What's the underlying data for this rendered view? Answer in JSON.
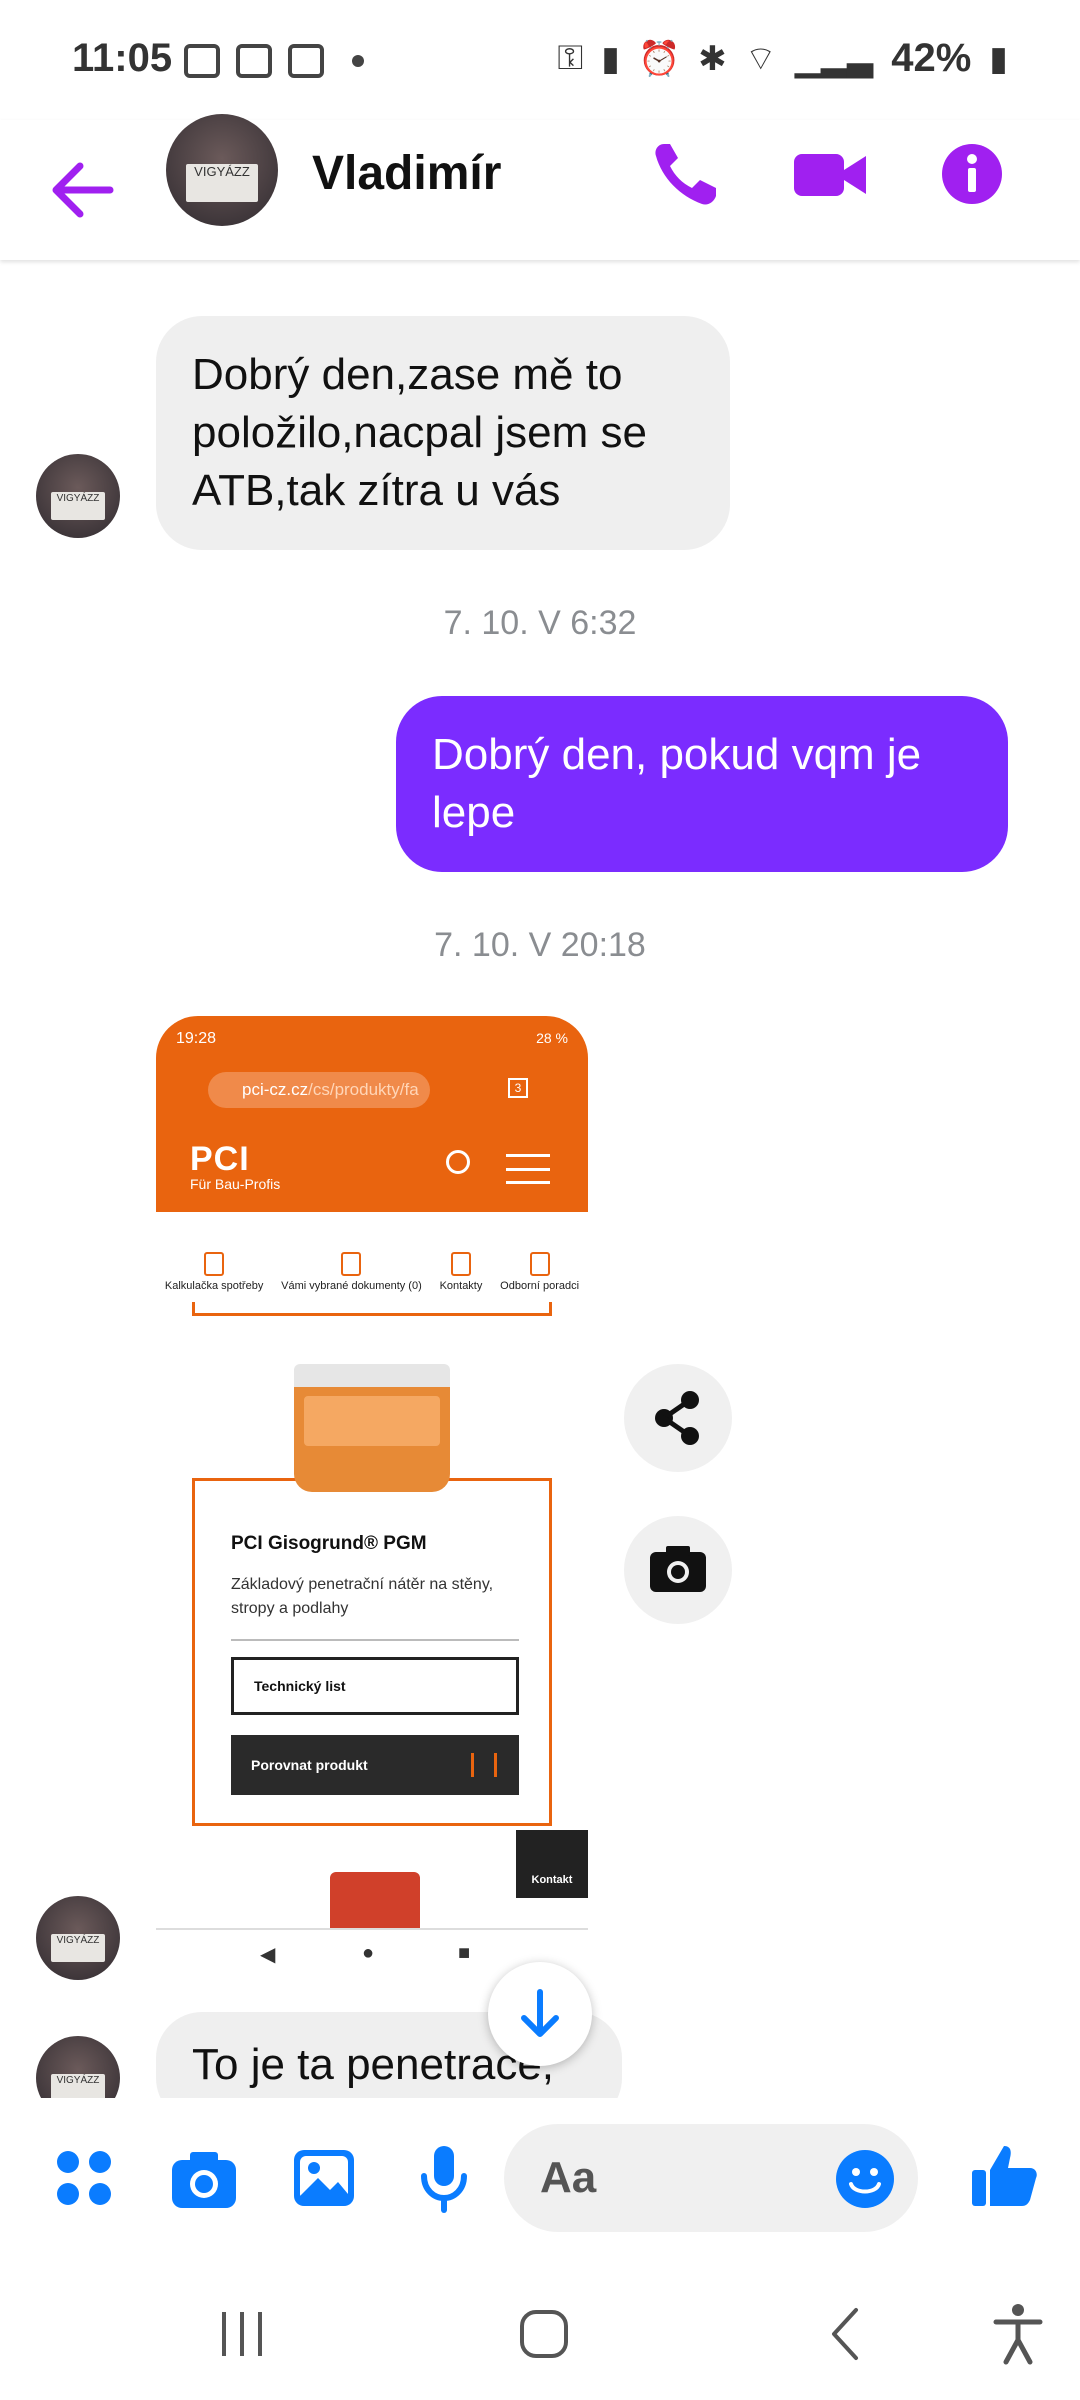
{
  "status_bar": {
    "time": "11:05",
    "battery": "42%"
  },
  "header": {
    "contact_name": "Vladimír",
    "avatar_text": "VIGYÁZZ",
    "icons": [
      "back-arrow-icon",
      "phone-icon",
      "video-camera-icon",
      "info-icon"
    ],
    "accent_color": "#a020f0"
  },
  "messages": [
    {
      "direction": "incoming",
      "text": "Dobrý den,zase mě to položilo,nacpal jsem se ATB,tak zítra u vás"
    },
    {
      "timestamp": "7. 10. V 6:32"
    },
    {
      "direction": "outgoing",
      "text": "Dobrý den,  pokud vqm je lepe"
    },
    {
      "timestamp": "7. 10. V 20:18"
    },
    {
      "direction": "incoming",
      "type": "image",
      "image": {
        "time": "19:28",
        "battery": "28 %",
        "url_host": "pci-cz.cz",
        "url_path": "/cs/produkty/fa",
        "tab_count": "3",
        "brand": "PCI",
        "brand_sub": "Für Bau-Profis",
        "nav_items": [
          "Kalkulačka spotřeby",
          "Vámi vybrané dokumenty (0)",
          "Kontakty",
          "Odborní poradci"
        ],
        "product_title": "PCI Gisogrund® PGM",
        "product_desc": "Základový penetrační nátěr na stěny, stropy a podlahy",
        "btn_tech": "Technický list",
        "btn_compare": "Porovnat produkt",
        "contact_label": "Kontakt"
      }
    },
    {
      "direction": "incoming",
      "text": "To je ta penetrace,"
    }
  ],
  "composer": {
    "placeholder": "Aa",
    "icons": [
      "apps-icon",
      "camera-icon",
      "gallery-icon",
      "microphone-icon",
      "emoji-icon",
      "like-icon"
    ],
    "icon_color": "#0a7cff"
  },
  "side_actions": [
    "share-icon",
    "camera-icon"
  ],
  "system_nav": [
    "recents-icon",
    "home-icon",
    "back-icon",
    "accessibility-icon"
  ]
}
